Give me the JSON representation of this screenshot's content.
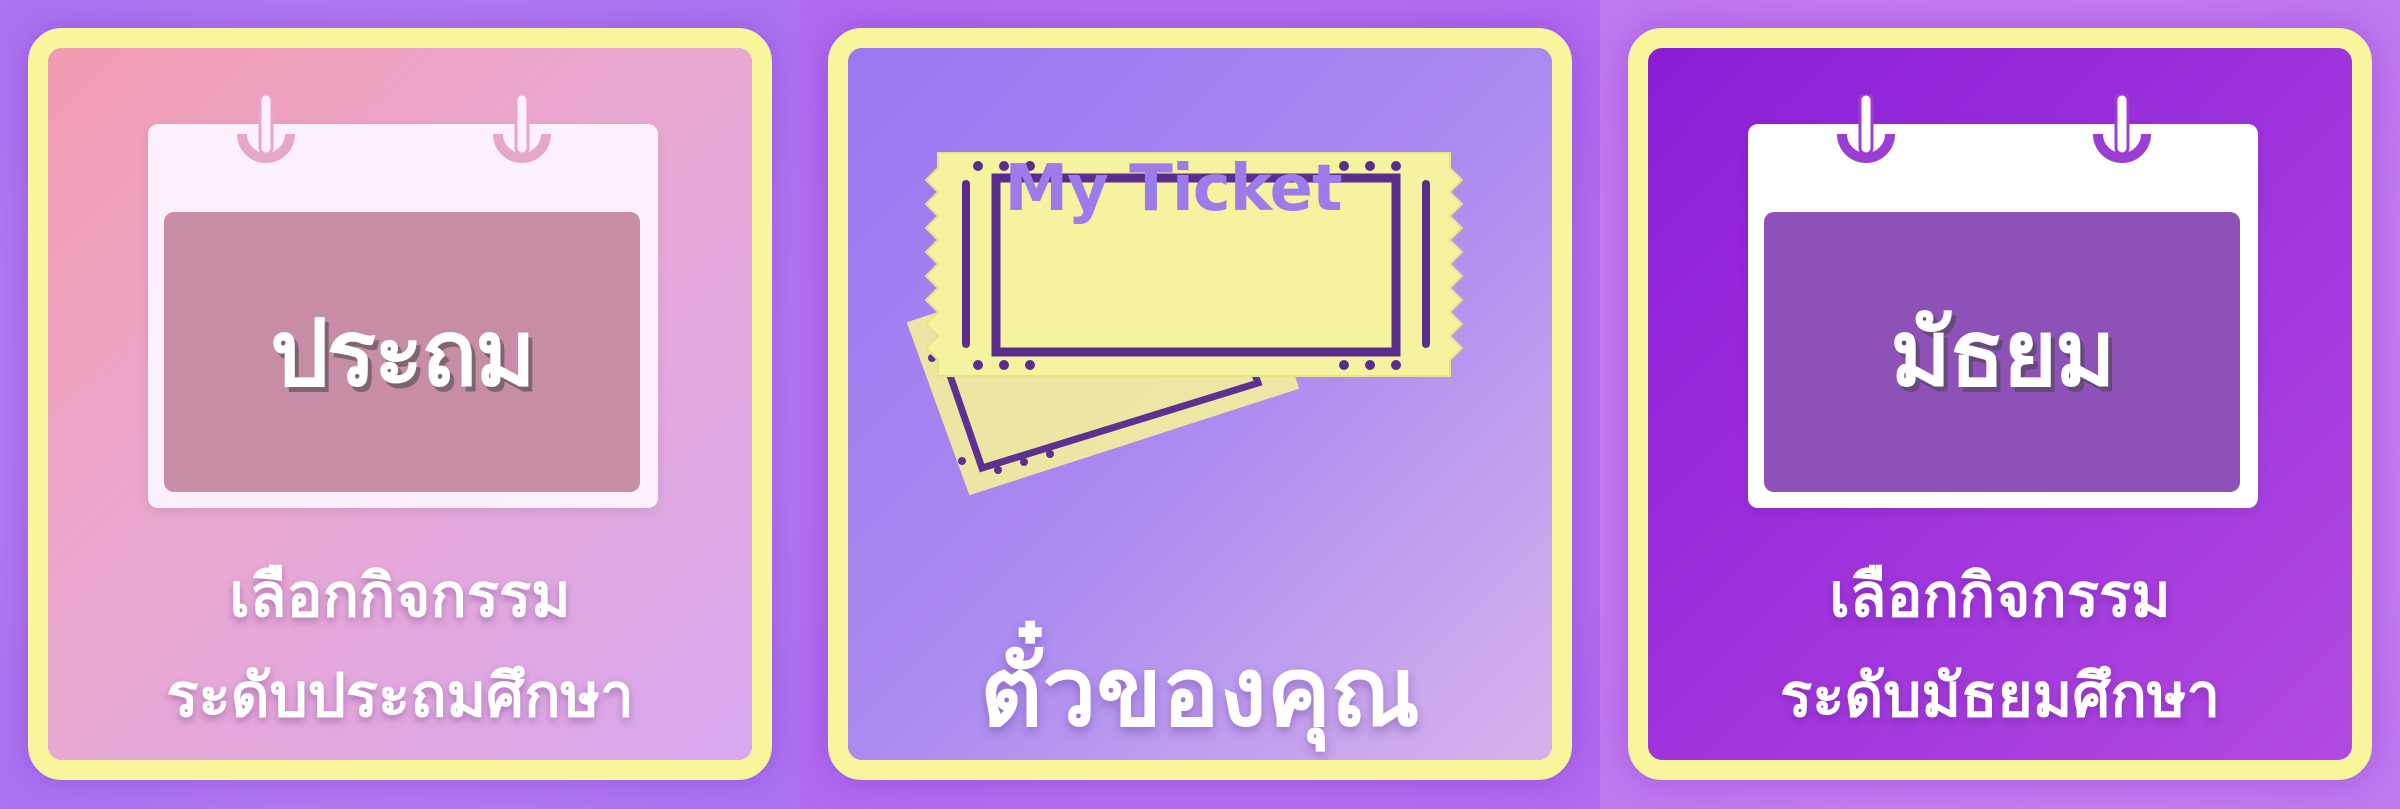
{
  "cards": {
    "primary": {
      "calendar_label": "ประถม",
      "caption_line_1": "เลือกกิจกรรม",
      "caption_line_2": "ระดับประถมศึกษา"
    },
    "ticket": {
      "ticket_title": "My Ticket",
      "caption": "ตั๋วของคุณ"
    },
    "secondary": {
      "calendar_label": "มัธยม",
      "caption_line_1": "เลือกกิจกรรม",
      "caption_line_2": "ระดับมัธยมศึกษา"
    }
  },
  "icons": [
    "calendar-icon",
    "ticket-icon",
    "calendar-icon"
  ],
  "colors": {
    "frame": "#f8f59a",
    "primary_card": "#f29bb0",
    "ticket_card": "#9a78f2",
    "secondary_card": "#8a1ed6",
    "ticket_paper": "#f6f3a0",
    "ticket_ink": "#5a2c8c"
  }
}
